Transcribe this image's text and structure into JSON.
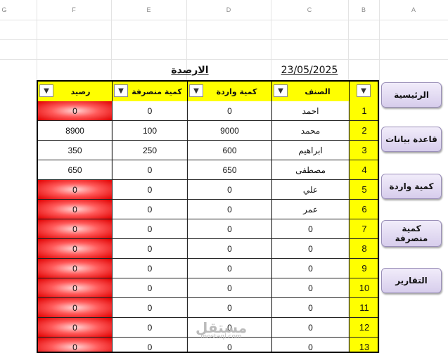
{
  "columns": {
    "g": "G",
    "f": "F",
    "e": "E",
    "d": "D",
    "c": "C",
    "b": "B",
    "a": "A"
  },
  "title": {
    "balances": "الارصدة",
    "date": "23/05/2025"
  },
  "headers": {
    "balance": "رصيد",
    "spent": "كمية منصرفة",
    "received": "كمية واردة",
    "item": "الصنف"
  },
  "filter_icon": "▼",
  "rows": [
    {
      "n": "1",
      "item": "احمد",
      "in": "0",
      "out": "0",
      "bal": "0",
      "red": true
    },
    {
      "n": "2",
      "item": "محمد",
      "in": "9000",
      "out": "100",
      "bal": "8900",
      "red": false
    },
    {
      "n": "3",
      "item": "ابراهيم",
      "in": "600",
      "out": "250",
      "bal": "350",
      "red": false
    },
    {
      "n": "4",
      "item": "مصطفى",
      "in": "650",
      "out": "0",
      "bal": "650",
      "red": false
    },
    {
      "n": "5",
      "item": "علي",
      "in": "0",
      "out": "0",
      "bal": "0",
      "red": true
    },
    {
      "n": "6",
      "item": "عمر",
      "in": "0",
      "out": "0",
      "bal": "0",
      "red": true
    },
    {
      "n": "7",
      "item": "0",
      "in": "0",
      "out": "0",
      "bal": "0",
      "red": true
    },
    {
      "n": "8",
      "item": "0",
      "in": "0",
      "out": "0",
      "bal": "0",
      "red": true
    },
    {
      "n": "9",
      "item": "0",
      "in": "0",
      "out": "0",
      "bal": "0",
      "red": true
    },
    {
      "n": "10",
      "item": "0",
      "in": "0",
      "out": "0",
      "bal": "0",
      "red": true
    },
    {
      "n": "11",
      "item": "0",
      "in": "0",
      "out": "0",
      "bal": "0",
      "red": true
    },
    {
      "n": "12",
      "item": "0",
      "in": "0",
      "out": "0",
      "bal": "0",
      "red": true
    },
    {
      "n": "13",
      "item": "0",
      "in": "0",
      "out": "0",
      "bal": "0",
      "red": true
    }
  ],
  "buttons": {
    "home": "الرئيسية",
    "database": "قاعدة بيانات",
    "received": "كمية واردة",
    "spent": "كمية منصرفة",
    "reports": "التقارير"
  },
  "watermark": {
    "logo": "مستقل",
    "site": "mostaql.com"
  }
}
